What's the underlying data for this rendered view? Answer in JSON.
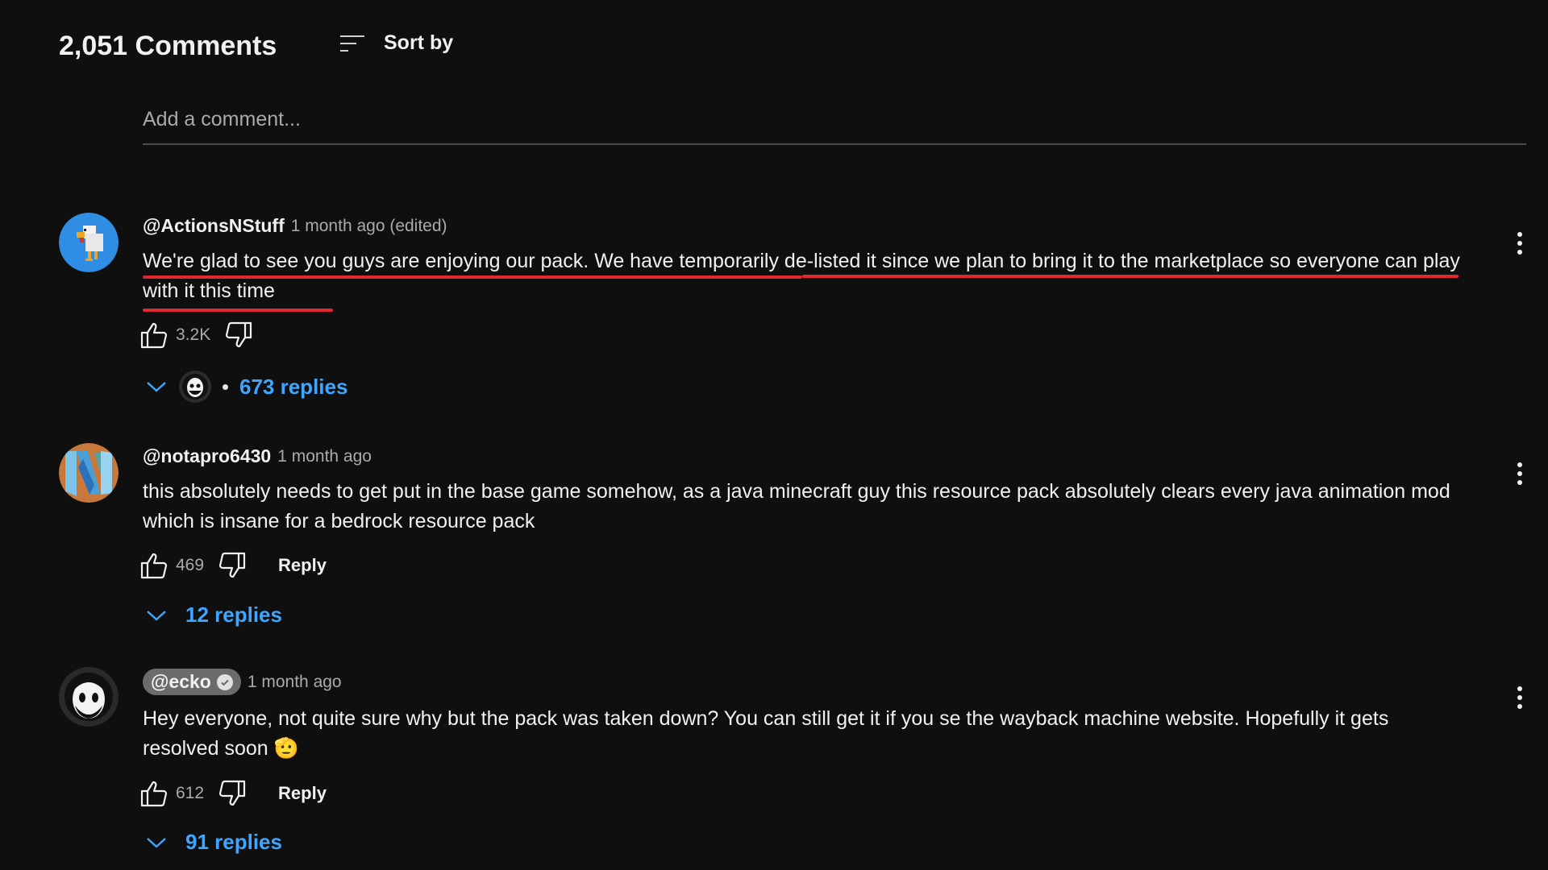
{
  "header": {
    "comment_count_label": "2,051 Comments",
    "sort_label": "Sort by",
    "sort_icon": "sort-lines-icon"
  },
  "composer": {
    "placeholder": "Add a comment..."
  },
  "comments": [
    {
      "author": "@ActionsNStuff",
      "author_highlighted": false,
      "verified": false,
      "timestamp": "1 month ago (edited)",
      "text": "We're glad to see you guys are enjoying our pack. We have temporarily de-listed it since we plan to bring it to the marketplace so everyone can play with it this time",
      "text_highlighted": true,
      "highlight_color": "#e0282e",
      "likes": "3.2K",
      "reply_label": "",
      "replies_label": "673 replies",
      "has_creator_reply_avatar": true,
      "avatar": "minecraft-chicken-avatar"
    },
    {
      "author": "@notapro6430",
      "author_highlighted": false,
      "verified": false,
      "timestamp": "1 month ago",
      "text": "this absolutely needs to get put in the base game somehow, as a java minecraft guy this resource pack absolutely clears every java animation mod which is insane for a bedrock resource pack",
      "likes": "469",
      "reply_label": "Reply",
      "replies_label": "12 replies",
      "avatar": "abstract-n-avatar"
    },
    {
      "author": "@ecko",
      "author_highlighted": true,
      "verified": true,
      "timestamp": "1 month ago",
      "text": "Hey everyone, not quite sure why but the pack was taken down? You can still get it if you se the wayback machine website. Hopefully it gets resolved soon",
      "emoji": "🫡",
      "likes": "612",
      "reply_label": "Reply",
      "replies_label": "91 replies",
      "avatar": "cartoon-bearded-face-avatar"
    }
  ],
  "colors": {
    "background": "#0f0f0f",
    "link_blue": "#3ea6ff",
    "highlight_red": "#e0282e",
    "muted_text": "#aaaaaa"
  }
}
